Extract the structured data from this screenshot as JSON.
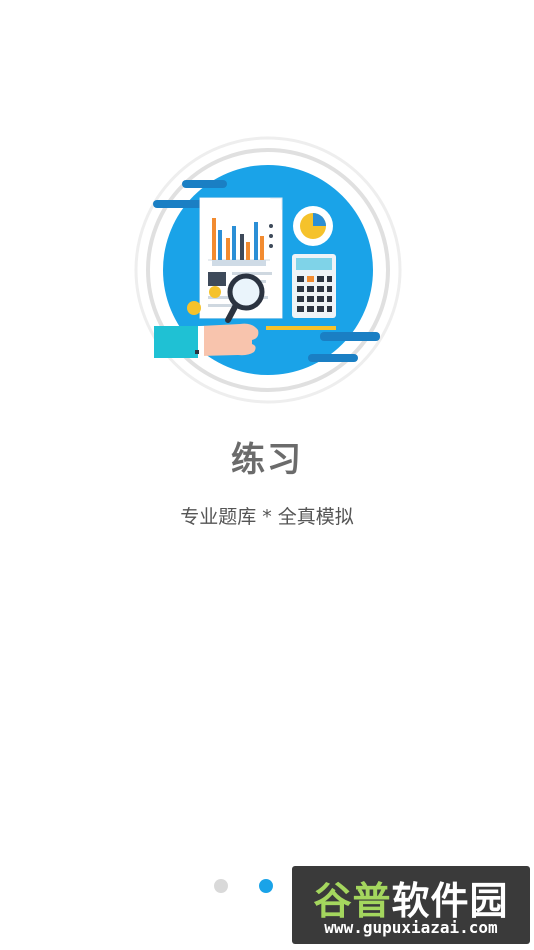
{
  "onboarding": {
    "title": "练习",
    "subtitle": "专业题库 * 全真模拟",
    "illustration_icon": "data-analysis-icon",
    "pagination": {
      "total": 2,
      "active_index": 1,
      "inactive_color": "#d9d9d9",
      "active_color": "#1aa3e8"
    }
  },
  "watermark": {
    "brand_part1": "谷普",
    "brand_part2": "软件园",
    "url": "www.gupuxiazai.com"
  },
  "colors": {
    "accent_blue": "#1aa3e8",
    "title_gray": "#6b6b6b"
  }
}
